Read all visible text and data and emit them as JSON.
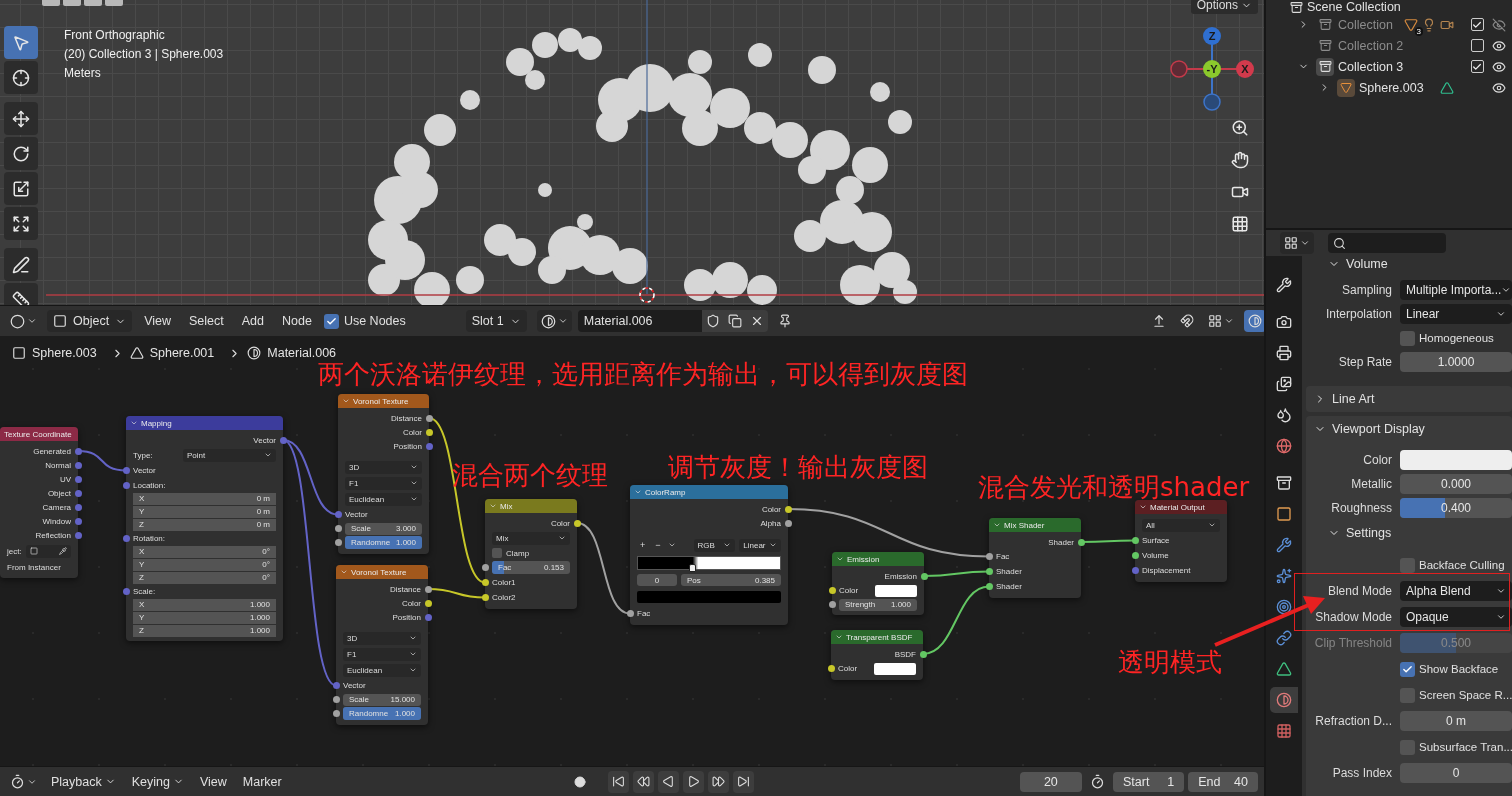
{
  "viewport": {
    "view_info": [
      "Front Orthographic",
      "(20) Collection 3 | Sphere.003",
      "Meters"
    ],
    "options": "Options",
    "tools": [
      {
        "kind": "select",
        "selected": true
      },
      {
        "kind": "cursor",
        "selected": false
      },
      {
        "kind": "move",
        "selected": false
      },
      {
        "kind": "rotate",
        "selected": false
      },
      {
        "kind": "scale",
        "selected": false
      },
      {
        "kind": "transform",
        "selected": false
      },
      {
        "kind": "annotate",
        "selected": false
      },
      {
        "kind": "measure",
        "selected": false
      }
    ],
    "gizmo": [
      {
        "label": "Z",
        "color": "#2f6fd0"
      },
      {
        "label": "-Y",
        "color": "#8bc92c"
      },
      {
        "label": "X",
        "color": "#d23a4c"
      }
    ]
  },
  "outliner": {
    "root": "Scene Collection",
    "items": [
      {
        "name": "Collection",
        "kind": "collection",
        "expanded": false,
        "checked": true,
        "visible": false,
        "contents": [
          {
            "kind": "mesh"
          },
          {
            "kind": "light"
          },
          {
            "kind": "camera"
          }
        ],
        "badge": "3"
      },
      {
        "name": "Collection 2",
        "kind": "collection",
        "checked": false,
        "visible": true
      },
      {
        "name": "Collection 3",
        "kind": "collection",
        "expanded": true,
        "checked": true,
        "visible": true,
        "children": [
          {
            "name": "Sphere.003",
            "kind": "object",
            "expanded": false,
            "visible": true,
            "contents": [
              {
                "kind": "mesh_data"
              }
            ]
          }
        ]
      }
    ]
  },
  "node_editor": {
    "mode": "Object",
    "menus": [
      "View",
      "Select",
      "Add",
      "Node"
    ],
    "use_nodes": {
      "label": "Use Nodes",
      "checked": true
    },
    "slot": "Slot 1",
    "material": "Material.006",
    "breadcrumb": [
      {
        "kind": "object",
        "label": "Sphere.003"
      },
      {
        "kind": "mesh",
        "label": "Sphere.001"
      },
      {
        "kind": "material",
        "label": "Material.006"
      }
    ],
    "annotations": [
      "两个沃洛诺伊纹理，选用距离作为输出，可以得到灰度图",
      "混合两个纹理",
      "调节灰度！输出灰度图",
      "混合发光和透明shader",
      "透明模式"
    ],
    "nodes": [
      {
        "title": "Texture Coordinate",
        "color": "#8c2a46",
        "rows": [
          {
            "kind": "output",
            "label": "Generated",
            "socket": {
              "color": "#6363c7"
            }
          },
          {
            "kind": "output",
            "label": "Normal",
            "socket": {
              "color": "#6363c7"
            }
          },
          {
            "kind": "output",
            "label": "UV",
            "socket": {
              "color": "#6363c7"
            }
          },
          {
            "kind": "output",
            "label": "Object",
            "socket": {
              "color": "#6363c7"
            }
          },
          {
            "kind": "output",
            "label": "Camera",
            "socket": {
              "color": "#6363c7"
            }
          },
          {
            "kind": "output",
            "label": "Window",
            "socket": {
              "color": "#6363c7"
            }
          },
          {
            "kind": "output",
            "label": "Reflection",
            "socket": {
              "color": "#6363c7"
            }
          },
          {
            "kind": "picker",
            "label": "ject:"
          },
          {
            "kind": "note",
            "label": "From Instancer"
          }
        ]
      },
      {
        "title": "Mapping",
        "color": "#3c3c9c",
        "rows": [
          {
            "kind": "output",
            "label": "Vector",
            "socket": {
              "color": "#6363c7"
            }
          },
          {
            "kind": "dropdown",
            "caption": "Type:",
            "label": "Point"
          },
          {
            "kind": "input",
            "label": "Vector",
            "socket": {
              "color": "#6363c7"
            }
          },
          {
            "kind": "label",
            "label": "Location:",
            "socket": {
              "color": "#6363c7"
            }
          },
          {
            "kind": "field",
            "label": "X",
            "value": "0 m"
          },
          {
            "kind": "field",
            "label": "Y",
            "value": "0 m"
          },
          {
            "kind": "field",
            "label": "Z",
            "value": "0 m"
          },
          {
            "kind": "label",
            "label": "Rotation:",
            "socket": {
              "color": "#6363c7"
            }
          },
          {
            "kind": "field",
            "label": "X",
            "value": "0°"
          },
          {
            "kind": "field",
            "label": "Y",
            "value": "0°"
          },
          {
            "kind": "field",
            "label": "Z",
            "value": "0°"
          },
          {
            "kind": "label",
            "label": "Scale:",
            "socket": {
              "color": "#6363c7"
            }
          },
          {
            "kind": "field",
            "label": "X",
            "value": "1.000"
          },
          {
            "kind": "field",
            "label": "Y",
            "value": "1.000"
          },
          {
            "kind": "field",
            "label": "Z",
            "value": "1.000"
          }
        ]
      },
      {
        "title": "Voronoi Texture",
        "color": "#a2581c",
        "rows": [
          {
            "kind": "output",
            "label": "Distance",
            "socket": {
              "color": "#a1a1a1"
            }
          },
          {
            "kind": "output",
            "label": "Color",
            "socket": {
              "color": "#c7c729"
            }
          },
          {
            "kind": "output",
            "label": "Position",
            "socket": {
              "color": "#6363c7"
            }
          },
          {
            "kind": "spacer"
          },
          {
            "kind": "dropdown",
            "label": "3D"
          },
          {
            "kind": "dropdown",
            "label": "F1"
          },
          {
            "kind": "dropdown",
            "label": "Euclidean"
          },
          {
            "kind": "input",
            "label": "Vector",
            "socket": {
              "color": "#6363c7"
            }
          },
          {
            "kind": "field",
            "label": "Scale",
            "value": "3.000",
            "socket": {
              "color": "#a1a1a1"
            }
          },
          {
            "kind": "slider",
            "label": "Randomne",
            "value": "1.000",
            "level": 1,
            "socket": {
              "color": "#a1a1a1"
            }
          }
        ]
      },
      {
        "title": "Voronoi Texture",
        "color": "#a2581c",
        "rows": [
          {
            "kind": "output",
            "label": "Distance",
            "socket": {
              "color": "#a1a1a1"
            }
          },
          {
            "kind": "output",
            "label": "Color",
            "socket": {
              "color": "#c7c729"
            }
          },
          {
            "kind": "output",
            "label": "Position",
            "socket": {
              "color": "#6363c7"
            }
          },
          {
            "kind": "spacer"
          },
          {
            "kind": "dropdown",
            "label": "3D"
          },
          {
            "kind": "dropdown",
            "label": "F1"
          },
          {
            "kind": "dropdown",
            "label": "Euclidean"
          },
          {
            "kind": "input",
            "label": "Vector",
            "socket": {
              "color": "#6363c7"
            }
          },
          {
            "kind": "field",
            "label": "Scale",
            "value": "15.000",
            "socket": {
              "color": "#a1a1a1"
            }
          },
          {
            "kind": "slider",
            "label": "Randomne",
            "value": "1.000",
            "level": 1,
            "socket": {
              "color": "#a1a1a1"
            }
          }
        ]
      },
      {
        "title": "Mix",
        "color": "#7a7a1e",
        "rows": [
          {
            "kind": "output",
            "label": "Color",
            "socket": {
              "color": "#c7c729"
            }
          },
          {
            "kind": "dropdown",
            "label": "Mix"
          },
          {
            "kind": "check",
            "label": "Clamp",
            "checked": false
          },
          {
            "kind": "slider",
            "label": "Fac",
            "value": "0.153",
            "level": 0.153,
            "socket": {
              "color": "#a1a1a1"
            }
          },
          {
            "kind": "input",
            "label": "Color1",
            "socket": {
              "color": "#c7c729"
            }
          },
          {
            "kind": "input",
            "label": "Color2",
            "socket": {
              "color": "#c7c729"
            }
          }
        ]
      },
      {
        "title": "ColorRamp",
        "color": "#2b6f9c",
        "rows": [
          {
            "kind": "output",
            "label": "Color",
            "socket": {
              "color": "#c7c729"
            }
          },
          {
            "kind": "output",
            "label": "Alpha",
            "socket": {
              "color": "#a1a1a1"
            }
          },
          {
            "kind": "spacer"
          },
          {
            "kind": "ramp_tools",
            "buttons": [
              "+",
              "−"
            ],
            "mode": "RGB",
            "interpolation": "Linear"
          },
          {
            "kind": "ramp_bar",
            "level": 0.385
          },
          {
            "kind": "ramp_stop",
            "index": "0",
            "label": "Pos",
            "value": "0.385"
          },
          {
            "kind": "ramp_color",
            "color": "#000000"
          },
          {
            "kind": "input",
            "label": "Fac",
            "socket": {
              "color": "#a1a1a1"
            }
          }
        ]
      },
      {
        "title": "Emission",
        "color": "#2a6a2c",
        "rows": [
          {
            "kind": "output",
            "label": "Emission",
            "socket": {
              "color": "#63c763"
            }
          },
          {
            "kind": "swatch",
            "label": "Color",
            "color": "#ffffff",
            "socket": {
              "color": "#c7c729"
            }
          },
          {
            "kind": "field",
            "label": "Strength",
            "value": "1.000",
            "socket": {
              "color": "#a1a1a1"
            }
          }
        ]
      },
      {
        "title": "Transparent BSDF",
        "color": "#2a6a2c",
        "rows": [
          {
            "kind": "output",
            "label": "BSDF",
            "socket": {
              "color": "#63c763"
            }
          },
          {
            "kind": "swatch",
            "label": "Color",
            "color": "#ffffff",
            "socket": {
              "color": "#c7c729"
            }
          }
        ]
      },
      {
        "title": "Mix Shader",
        "color": "#2a6a2c",
        "rows": [
          {
            "kind": "output",
            "label": "Shader",
            "socket": {
              "color": "#63c763"
            }
          },
          {
            "kind": "input",
            "label": "Fac",
            "socket": {
              "color": "#a1a1a1"
            }
          },
          {
            "kind": "input",
            "label": "Shader",
            "socket": {
              "color": "#63c763"
            }
          },
          {
            "kind": "input",
            "label": "Shader",
            "socket": {
              "color": "#63c763"
            }
          }
        ]
      },
      {
        "title": "Material Output",
        "color": "#5c1f22",
        "rows": [
          {
            "kind": "dropdown",
            "label": "All"
          },
          {
            "kind": "input",
            "label": "Surface",
            "socket": {
              "color": "#63c763"
            }
          },
          {
            "kind": "input",
            "label": "Volume",
            "socket": {
              "color": "#63c763"
            }
          },
          {
            "kind": "input",
            "label": "Displacement",
            "socket": {
              "color": "#6363c7"
            }
          }
        ]
      }
    ]
  },
  "properties": {
    "tabs": [
      {
        "kind": "tool",
        "selected": false
      },
      {
        "kind": "render",
        "selected": false
      },
      {
        "kind": "output",
        "selected": false
      },
      {
        "kind": "view_layer",
        "selected": false
      },
      {
        "kind": "scene",
        "selected": false
      },
      {
        "kind": "world",
        "selected": false
      },
      {
        "kind": "collection",
        "selected": false
      },
      {
        "kind": "object",
        "selected": false
      },
      {
        "kind": "modifier",
        "selected": false
      },
      {
        "kind": "particles",
        "selected": false
      },
      {
        "kind": "physics",
        "selected": false
      },
      {
        "kind": "constraints",
        "selected": false
      },
      {
        "kind": "data",
        "selected": false
      },
      {
        "kind": "material",
        "selected": true
      },
      {
        "kind": "texture",
        "selected": false
      }
    ],
    "sections": [
      {
        "kind": "subpanel",
        "label": "Volume",
        "expanded": true,
        "rows": [
          {
            "kind": "dropdown",
            "label": "Sampling",
            "value": "Multiple Importa...",
            "disabled": false
          },
          {
            "kind": "dropdown",
            "label": "Interpolation",
            "value": "Linear",
            "disabled": false
          },
          {
            "kind": "check",
            "label": "Homogeneous",
            "checked": false,
            "disabled": false
          },
          {
            "kind": "number",
            "label": "Step Rate",
            "value": "1.0000",
            "disabled": false
          }
        ]
      },
      {
        "kind": "panel",
        "label": "Line Art",
        "expanded": false
      },
      {
        "kind": "panel",
        "label": "Viewport Display",
        "expanded": true,
        "rows": [
          {
            "kind": "swatch",
            "label": "Color",
            "color": "#eeeeee",
            "disabled": false
          },
          {
            "kind": "slider",
            "label": "Metallic",
            "value": "0.000",
            "level": 0,
            "disabled": false
          },
          {
            "kind": "slider",
            "label": "Roughness",
            "value": "0.400",
            "level": 0.4,
            "disabled": false
          }
        ],
        "sections": [
          {
            "kind": "subpanel",
            "label": "Settings",
            "expanded": true,
            "rows": [
              {
                "kind": "check",
                "label": "Backface Culling",
                "checked": false,
                "disabled": false
              },
              {
                "kind": "dropdown",
                "label": "Blend Mode",
                "value": "Alpha Blend",
                "disabled": false
              },
              {
                "kind": "dropdown",
                "label": "Shadow Mode",
                "value": "Opaque",
                "disabled": false
              },
              {
                "kind": "slider",
                "label": "Clip Threshold",
                "value": "0.500",
                "level": 0.5,
                "disabled": true
              },
              {
                "kind": "check",
                "label": "Show Backface",
                "checked": true,
                "disabled": false
              },
              {
                "kind": "check",
                "label": "Screen Space R...",
                "checked": false,
                "disabled": false
              },
              {
                "kind": "number",
                "label": "Refraction D...",
                "value": "0 m",
                "disabled": false
              },
              {
                "kind": "check",
                "label": "Subsurface Tran...",
                "checked": false,
                "disabled": false
              },
              {
                "kind": "number",
                "label": "Pass Index",
                "value": "0",
                "disabled": false
              }
            ]
          }
        ]
      }
    ]
  },
  "timeline": {
    "menus": [
      {
        "label": "Playback",
        "dropdown": true
      },
      {
        "label": "Keying",
        "dropdown": true
      },
      {
        "label": "View",
        "dropdown": false
      },
      {
        "label": "Marker",
        "dropdown": false
      }
    ],
    "current_frame": "20",
    "start": {
      "label": "Start",
      "value": "1"
    },
    "end": {
      "label": "End",
      "value": "40"
    }
  }
}
